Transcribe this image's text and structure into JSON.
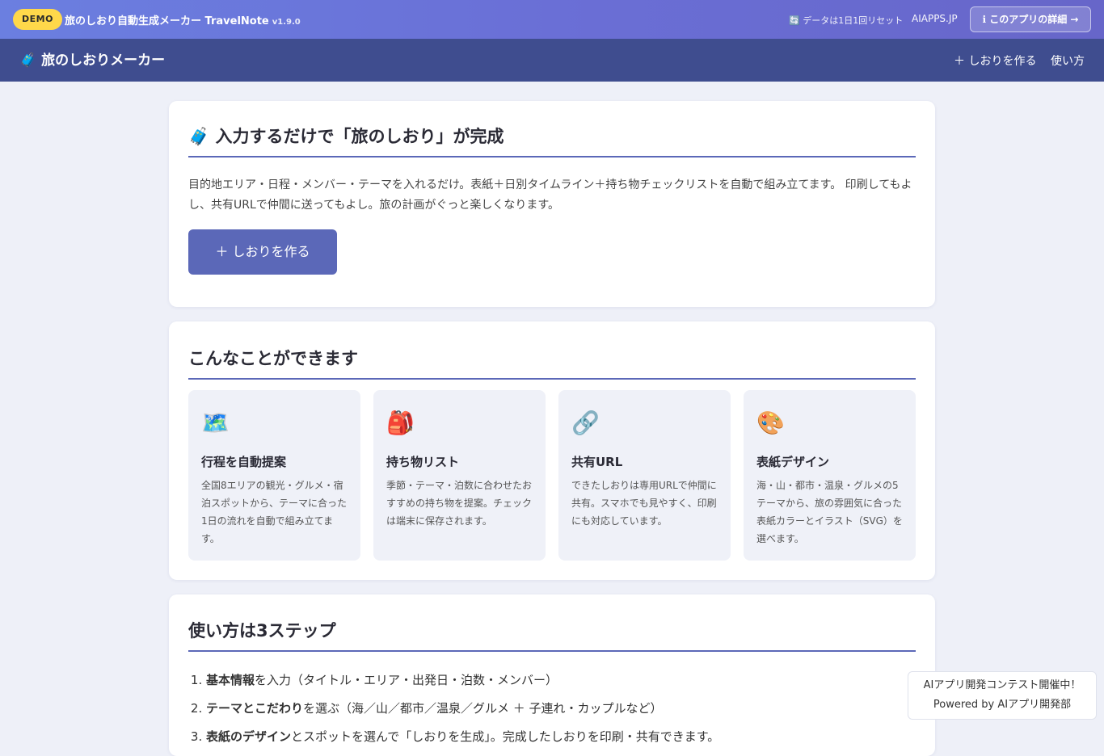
{
  "demo_bar": {
    "badge": "DEMO",
    "app_title": "旅のしおり自動生成メーカー TravelNote",
    "version": "v1.9.0",
    "reset_notice": "🔄 データは1日1回リセット",
    "site_name": "AIAPPS.JP",
    "detail_button": "ℹ このアプリの詳細 →"
  },
  "header": {
    "logo": "🧳 旅のしおりメーカー",
    "nav": [
      {
        "label": "＋ しおりを作る"
      },
      {
        "label": "使い方"
      }
    ]
  },
  "hero": {
    "title": "🧳 入力するだけで「旅のしおり」が完成",
    "description": "目的地エリア・日程・メンバー・テーマを入れるだけ。表紙＋日別タイムライン＋持ち物チェックリストを自動で組み立てます。 印刷してもよし、共有URLで仲間に送ってもよし。旅の計画がぐっと楽しくなります。",
    "cta_label": "＋ しおりを作る"
  },
  "features": {
    "title": "こんなことができます",
    "items": [
      {
        "icon": "🗺️",
        "icon_name": "map-icon",
        "title": "行程を自動提案",
        "text": "全国8エリアの観光・グルメ・宿泊スポットから、テーマに合った1日の流れを自動で組み立てます。"
      },
      {
        "icon": "🎒",
        "icon_name": "backpack-icon",
        "title": "持ち物リスト",
        "text": "季節・テーマ・泊数に合わせたおすすめの持ち物を提案。チェックは端末に保存されます。"
      },
      {
        "icon": "🔗",
        "icon_name": "link-icon",
        "title": "共有URL",
        "text": "できたしおりは専用URLで仲間に共有。スマホでも見やすく、印刷にも対応しています。"
      },
      {
        "icon": "🎨",
        "icon_name": "palette-icon",
        "title": "表紙デザイン",
        "text": "海・山・都市・温泉・グルメの5テーマから、旅の雰囲気に合った表紙カラーとイラスト（SVG）を選べます。"
      }
    ]
  },
  "steps": {
    "title": "使い方は3ステップ",
    "items": [
      {
        "bold": "基本情報",
        "rest": "を入力（タイトル・エリア・出発日・泊数・メンバー）"
      },
      {
        "bold": "テーマとこだわり",
        "rest": "を選ぶ（海／山／都市／温泉／グルメ ＋ 子連れ・カップルなど）"
      },
      {
        "bold": "表紙のデザイン",
        "rest": "とスポットを選んで「しおりを生成」。完成したしおりを印刷・共有できます。"
      }
    ]
  },
  "contest": {
    "line1": "AIアプリ開発コンテスト開催中！",
    "line2": "Powered by AIアプリ開発部"
  },
  "colors": {
    "accent": "#5b68b8",
    "header_bg": "#3f4d8f",
    "badge_yellow": "#ffd84a",
    "page_bg": "#eef0f8"
  }
}
